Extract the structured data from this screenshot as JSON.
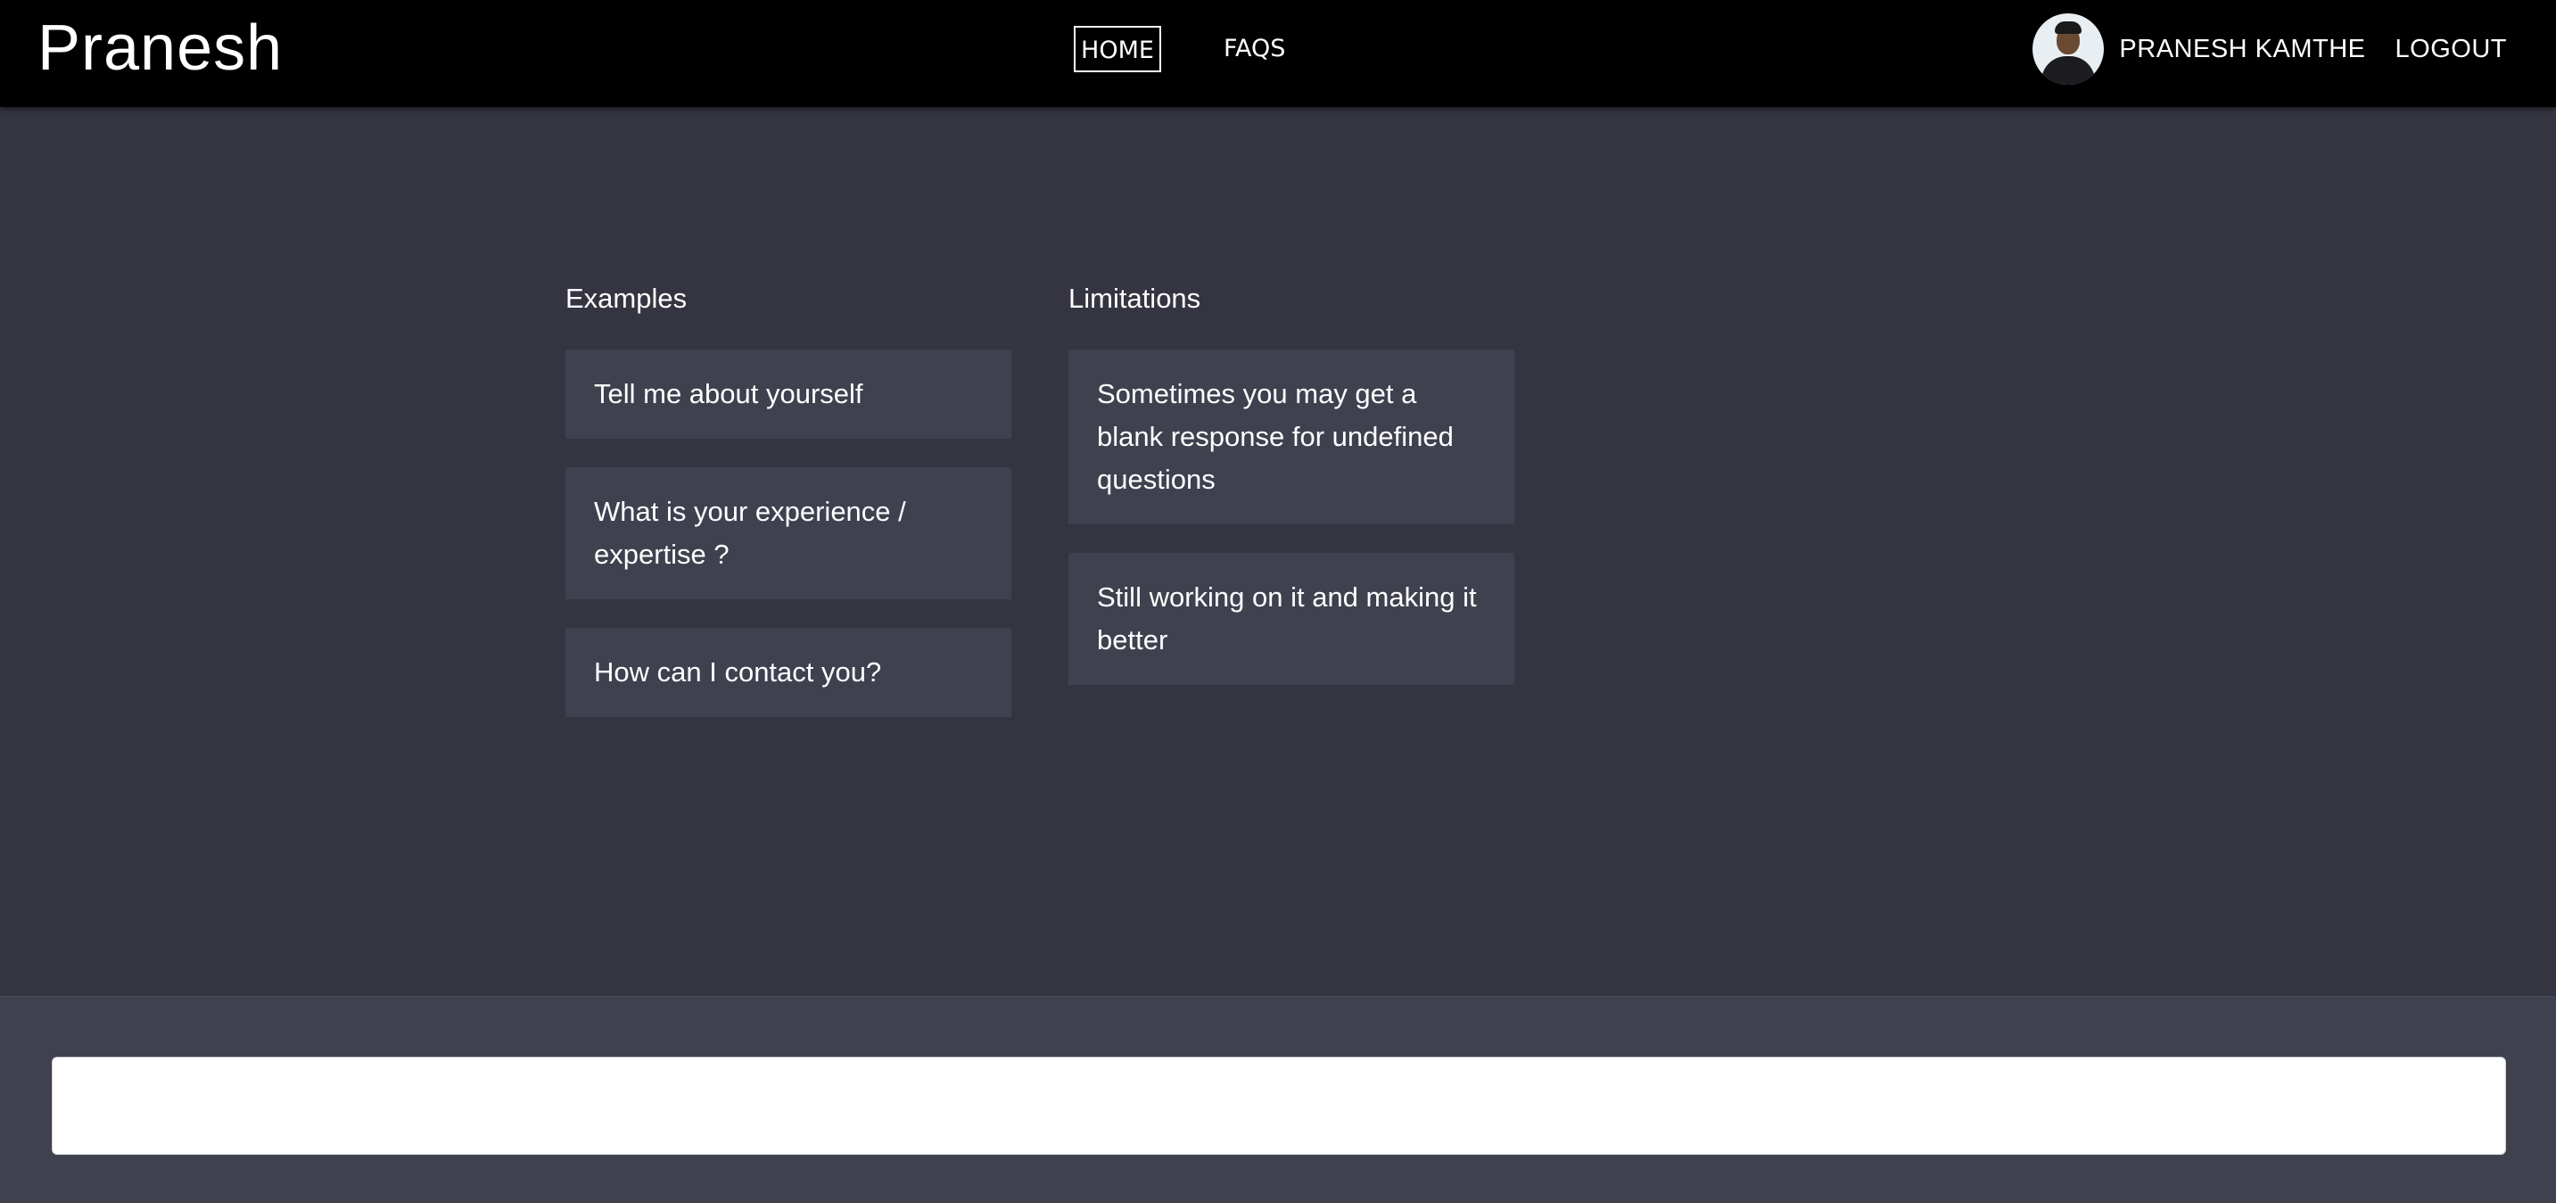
{
  "navbar": {
    "brand": "Pranesh",
    "links": [
      {
        "label": "HOME",
        "active": true
      },
      {
        "label": "FAQS",
        "active": false
      }
    ],
    "user_name": "PRANESH KAMTHE",
    "logout_label": "LOGOUT",
    "avatar_icon": "user-avatar-photo"
  },
  "main": {
    "examples": {
      "heading": "Examples",
      "items": [
        "Tell me about yourself",
        "What is your experience / expertise ?",
        "How can I contact you?"
      ]
    },
    "limitations": {
      "heading": "Limitations",
      "items": [
        "Sometimes you may get a blank response for undefined questions",
        "Still working on it and making it better"
      ]
    }
  },
  "footer": {
    "input_value": "",
    "input_placeholder": ""
  },
  "colors": {
    "navbar_bg": "#000000",
    "page_bg": "#343541",
    "card_bg": "#40414f",
    "footer_bg": "#40414f",
    "text": "#ffffff"
  }
}
